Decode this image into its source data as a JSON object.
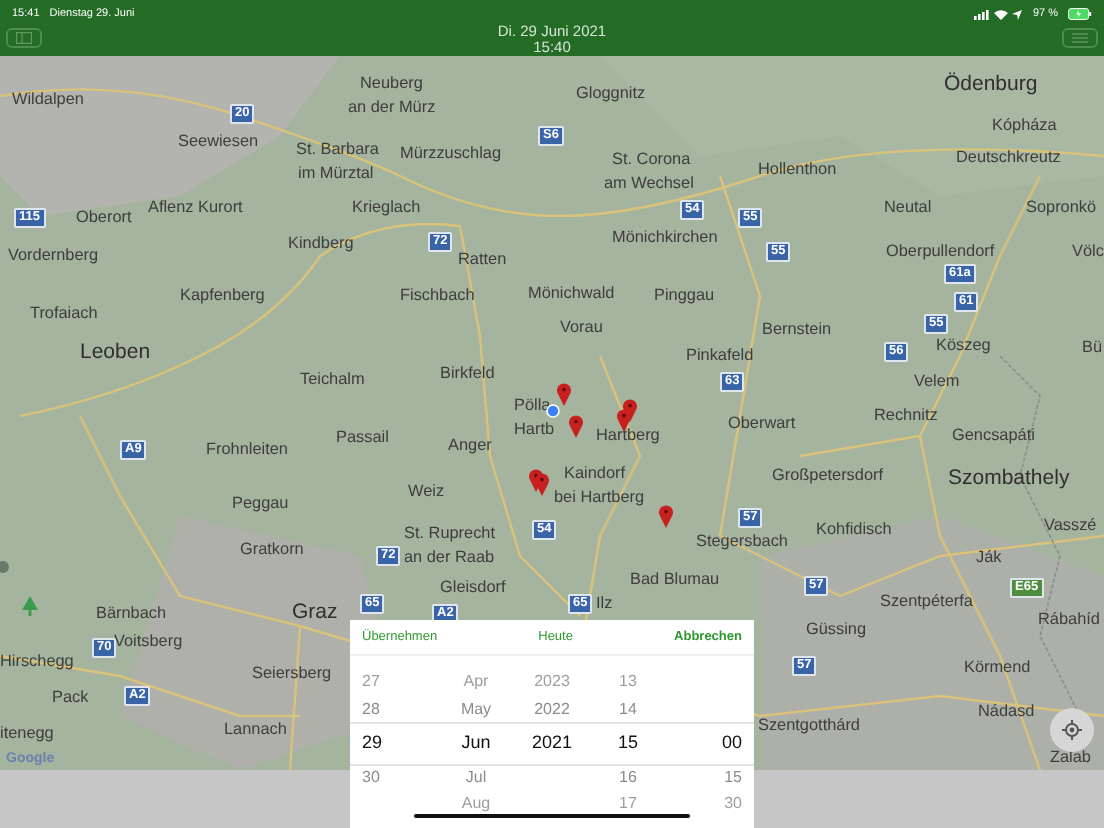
{
  "status_bar": {
    "time": "15:41",
    "date": "Dienstag 29. Juni",
    "battery": "97 %"
  },
  "header": {
    "title": "Di. 29 Juni 2021",
    "subtitle": "15:40"
  },
  "map": {
    "labels": [
      {
        "kind": "place",
        "text": "Wildalpen"
      },
      {
        "kind": "road",
        "text": "20"
      },
      {
        "kind": "place",
        "text": "Neuberg"
      },
      {
        "kind": "place",
        "text": "an der Mürz"
      },
      {
        "kind": "place",
        "text": "Seewiesen"
      },
      {
        "kind": "place",
        "text": "St. Barbara"
      },
      {
        "kind": "place",
        "text": "im Mürztal"
      },
      {
        "kind": "place",
        "text": "Mürzzuschlag"
      },
      {
        "kind": "road",
        "text": "S6"
      },
      {
        "kind": "place",
        "text": "Gloggnitz"
      },
      {
        "kind": "city",
        "text": "Ödenburg"
      },
      {
        "kind": "place",
        "text": "Kópháza"
      },
      {
        "kind": "place",
        "text": "St. Corona"
      },
      {
        "kind": "place",
        "text": "Deutschkreutz"
      },
      {
        "kind": "place",
        "text": "am Wechsel"
      },
      {
        "kind": "place",
        "text": "Hollenthon"
      },
      {
        "kind": "place",
        "text": "Neutal"
      },
      {
        "kind": "place",
        "text": "Sopronkö"
      },
      {
        "kind": "road",
        "text": "115"
      },
      {
        "kind": "place",
        "text": "Oberort"
      },
      {
        "kind": "place",
        "text": "Aflenz Kurort"
      },
      {
        "kind": "place",
        "text": "Krieglach"
      },
      {
        "kind": "road",
        "text": "54"
      },
      {
        "kind": "road",
        "text": "55"
      },
      {
        "kind": "place",
        "text": "Mönichkirchen"
      },
      {
        "kind": "place",
        "text": "Vordernberg"
      },
      {
        "kind": "place",
        "text": "Kindberg"
      },
      {
        "kind": "road",
        "text": "72"
      },
      {
        "kind": "road",
        "text": "55"
      },
      {
        "kind": "place",
        "text": "Oberpullendorf"
      },
      {
        "kind": "place",
        "text": "Völc"
      },
      {
        "kind": "place",
        "text": "Ratten"
      },
      {
        "kind": "road",
        "text": "61a"
      },
      {
        "kind": "place",
        "text": "Kapfenberg"
      },
      {
        "kind": "place",
        "text": "Fischbach"
      },
      {
        "kind": "place",
        "text": "Mönichwald"
      },
      {
        "kind": "place",
        "text": "Pinggau"
      },
      {
        "kind": "road",
        "text": "61"
      },
      {
        "kind": "place",
        "text": "Trofaiach"
      },
      {
        "kind": "place",
        "text": "Vorau"
      },
      {
        "kind": "place",
        "text": "Bernstein"
      },
      {
        "kind": "road",
        "text": "55"
      },
      {
        "kind": "city",
        "text": "Leoben"
      },
      {
        "kind": "place",
        "text": "Pinkafeld"
      },
      {
        "kind": "road",
        "text": "56"
      },
      {
        "kind": "place",
        "text": "Köszeg"
      },
      {
        "kind": "place",
        "text": "Bü"
      },
      {
        "kind": "place",
        "text": "Teichalm"
      },
      {
        "kind": "place",
        "text": "Birkfeld"
      },
      {
        "kind": "road",
        "text": "63"
      },
      {
        "kind": "place",
        "text": "Velem"
      },
      {
        "kind": "place",
        "text": "Pölla"
      },
      {
        "kind": "road",
        "text": "A9"
      },
      {
        "kind": "place",
        "text": "Frohnleiten"
      },
      {
        "kind": "place",
        "text": "Passail"
      },
      {
        "kind": "place",
        "text": "Anger"
      },
      {
        "kind": "place",
        "text": "Hartb"
      },
      {
        "kind": "place",
        "text": "Hartberg"
      },
      {
        "kind": "place",
        "text": "Oberwart"
      },
      {
        "kind": "place",
        "text": "Rechnitz"
      },
      {
        "kind": "place",
        "text": "Gencsapáti"
      },
      {
        "kind": "place",
        "text": "Kaindorf"
      },
      {
        "kind": "place",
        "text": "Großpetersdorf"
      },
      {
        "kind": "city",
        "text": "Szombathely"
      },
      {
        "kind": "place",
        "text": "Peggau"
      },
      {
        "kind": "place",
        "text": "Weiz"
      },
      {
        "kind": "place",
        "text": "bei Hartberg"
      },
      {
        "kind": "place",
        "text": "St. Ruprecht"
      },
      {
        "kind": "road",
        "text": "54"
      },
      {
        "kind": "road",
        "text": "57"
      },
      {
        "kind": "place",
        "text": "Kohfidisch"
      },
      {
        "kind": "place",
        "text": "Vasszé"
      },
      {
        "kind": "place",
        "text": "Gratkorn"
      },
      {
        "kind": "road",
        "text": "72"
      },
      {
        "kind": "place",
        "text": "an der Raab"
      },
      {
        "kind": "place",
        "text": "Stegersbach"
      },
      {
        "kind": "place",
        "text": "Ják"
      },
      {
        "kind": "place",
        "text": "Gleisdorf"
      },
      {
        "kind": "place",
        "text": "Bad Blumau"
      },
      {
        "kind": "road",
        "text": "57"
      },
      {
        "kind": "euro-road",
        "text": "E65"
      },
      {
        "kind": "place",
        "text": "Bärnbach"
      },
      {
        "kind": "city",
        "text": "Graz"
      },
      {
        "kind": "road",
        "text": "65"
      },
      {
        "kind": "road",
        "text": "A2"
      },
      {
        "kind": "road",
        "text": "65"
      },
      {
        "kind": "place",
        "text": "Ilz"
      },
      {
        "kind": "place",
        "text": "Szentpéterfa"
      },
      {
        "kind": "road",
        "text": "70"
      },
      {
        "kind": "place",
        "text": "Voitsberg"
      },
      {
        "kind": "place",
        "text": "Güssing"
      },
      {
        "kind": "place",
        "text": "Rábahíd"
      },
      {
        "kind": "place",
        "text": "Hirschegg"
      },
      {
        "kind": "place",
        "text": "Seiersberg"
      },
      {
        "kind": "road",
        "text": "57"
      },
      {
        "kind": "place",
        "text": "Körmend"
      },
      {
        "kind": "place",
        "text": "Pack"
      },
      {
        "kind": "road",
        "text": "A2"
      },
      {
        "kind": "place",
        "text": "itenegg"
      },
      {
        "kind": "place",
        "text": "Lannach"
      },
      {
        "kind": "place",
        "text": "Szentgotthárd"
      },
      {
        "kind": "place",
        "text": "Nádasd"
      },
      {
        "kind": "place",
        "text": "Zalab"
      }
    ],
    "attribution": "Google"
  },
  "picker": {
    "actions": [
      "Übernehmen",
      "Heute",
      "Abbrechen"
    ],
    "columns": [
      {
        "items": [
          {
            "text": "27",
            "selected": false
          },
          {
            "text": "28",
            "selected": false
          },
          {
            "text": "29",
            "selected": true
          },
          {
            "text": "30",
            "selected": false
          }
        ]
      },
      {
        "items": [
          {
            "text": "Apr",
            "selected": false
          },
          {
            "text": "May",
            "selected": false
          },
          {
            "text": "Jun",
            "selected": true
          },
          {
            "text": "Jul",
            "selected": false
          },
          {
            "text": "Aug",
            "selected": false
          }
        ]
      },
      {
        "items": [
          {
            "text": "2023",
            "selected": false
          },
          {
            "text": "2022",
            "selected": false
          },
          {
            "text": "2021",
            "selected": true
          }
        ]
      },
      {
        "items": [
          {
            "text": "13",
            "selected": false
          },
          {
            "text": "14",
            "selected": false
          },
          {
            "text": "15",
            "selected": true
          },
          {
            "text": "16",
            "selected": false
          },
          {
            "text": "17",
            "selected": false
          }
        ]
      },
      {
        "items": [
          {
            "text": "00",
            "selected": true
          },
          {
            "text": "15",
            "selected": false
          },
          {
            "text": "30",
            "selected": false
          }
        ]
      }
    ]
  }
}
